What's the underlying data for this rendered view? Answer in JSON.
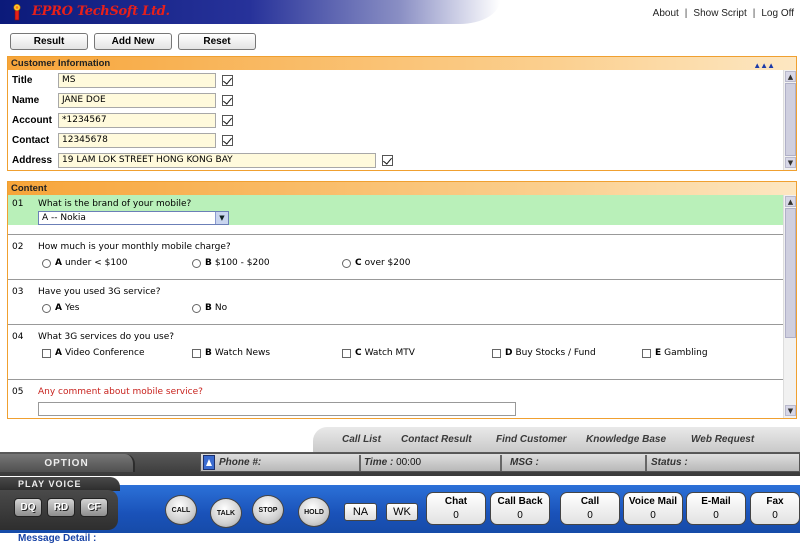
{
  "header": {
    "brand": "EPRO TechSoft Ltd.",
    "links": [
      "About",
      "Show Script",
      "Log Off"
    ],
    "separator": "|"
  },
  "toolbar": {
    "result_label": "Result",
    "add_new_label": "Add New",
    "reset_label": "Reset"
  },
  "customer": {
    "title": "Customer Information",
    "fields": [
      {
        "label": "Title",
        "value": "MS",
        "checked": true
      },
      {
        "label": "Name",
        "value": "JANE DOE",
        "checked": true
      },
      {
        "label": "Account",
        "value": "*1234567",
        "checked": true
      },
      {
        "label": "Contact",
        "value": "12345678",
        "checked": true
      },
      {
        "label": "Address",
        "value": "19 LAM LOK STREET HONG KONG BAY",
        "checked": true
      }
    ]
  },
  "content": {
    "title": "Content",
    "questions": [
      {
        "num": "01",
        "text": "What is the brand of your mobile?",
        "selected": "A -- Nokia"
      },
      {
        "num": "02",
        "text": "How much is your monthly mobile charge?",
        "options": [
          {
            "key": "A",
            "text": "under < $100"
          },
          {
            "key": "B",
            "text": "$100 - $200"
          },
          {
            "key": "C",
            "text": "over $200"
          }
        ]
      },
      {
        "num": "03",
        "text": "Have you used 3G service?",
        "options": [
          {
            "key": "A",
            "text": "Yes"
          },
          {
            "key": "B",
            "text": "No"
          }
        ]
      },
      {
        "num": "04",
        "text": "What 3G services do you use?",
        "options": [
          {
            "key": "A",
            "text": "Video Conference"
          },
          {
            "key": "B",
            "text": "Watch News"
          },
          {
            "key": "C",
            "text": "Watch MTV"
          },
          {
            "key": "D",
            "text": "Buy Stocks / Fund"
          },
          {
            "key": "E",
            "text": "Gambling"
          }
        ]
      },
      {
        "num": "05",
        "text": "Any comment about mobile service?"
      }
    ]
  },
  "console": {
    "tabs": [
      "Call List",
      "Contact Result",
      "Find Customer",
      "Knowledge Base",
      "Web Request"
    ],
    "option_label": "OPTION",
    "play_voice_label": "PLAY VOICE",
    "phone_label": "Phone #:",
    "time_label": "Time :",
    "time_value": "00:00",
    "msg_label": "MSG :",
    "status_label": "Status :",
    "voice_buttons": [
      "DQ",
      "RD",
      "CF"
    ],
    "call_buttons": [
      "CALL",
      "TALK",
      "STOP",
      "HOLD"
    ],
    "small_buttons": [
      "NA",
      "WK"
    ],
    "counters": [
      {
        "label": "Chat",
        "value": "0"
      },
      {
        "label": "Call Back",
        "value": "0"
      },
      {
        "label": "Call",
        "value": "0"
      },
      {
        "label": "Voice Mail",
        "value": "0"
      },
      {
        "label": "E-Mail",
        "value": "0"
      },
      {
        "label": "Fax",
        "value": "0"
      }
    ],
    "message_detail_label": "Message Detail :"
  },
  "colors": {
    "brand_red": "#e8201a",
    "panel_orange": "#f7a53a",
    "selected_green": "#b9f0b9",
    "console_blue": "#1a52b9",
    "comment_red": "#c8231e"
  }
}
